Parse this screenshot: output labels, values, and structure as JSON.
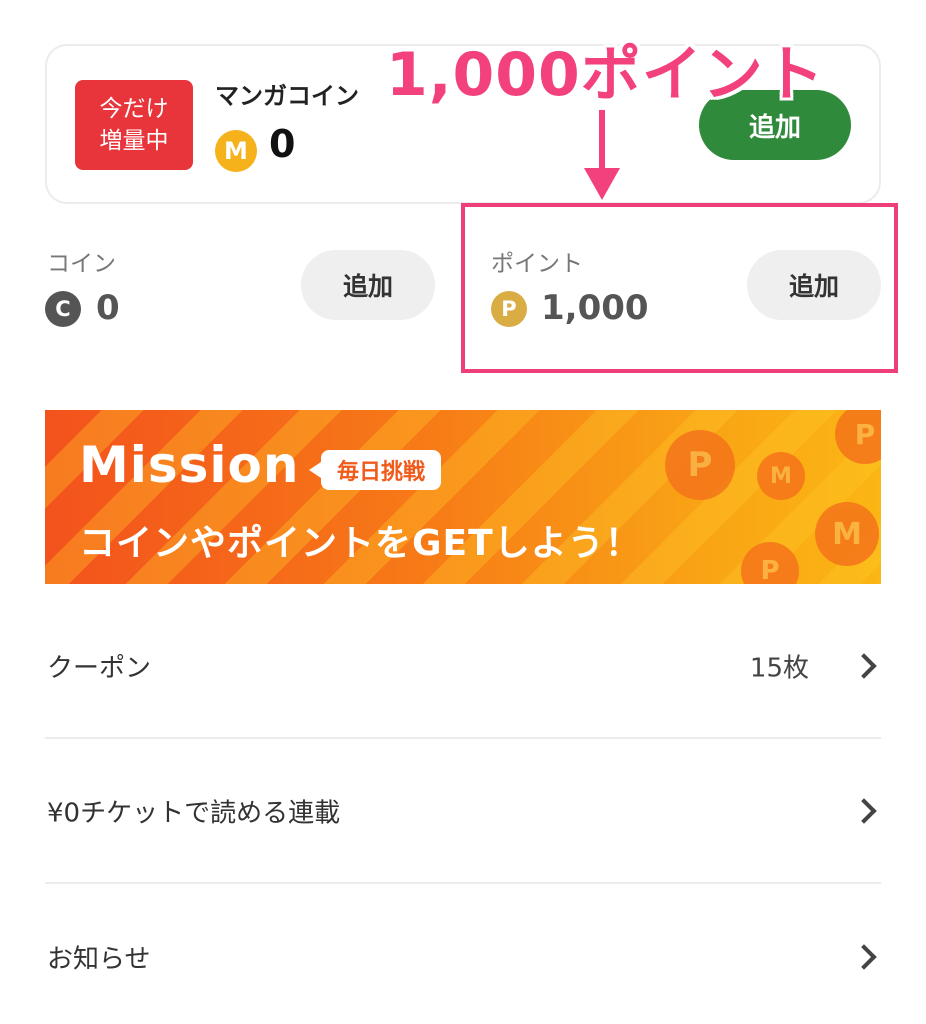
{
  "annotation": {
    "title": "1,000ポイント"
  },
  "manga_coin": {
    "badge_line1": "今だけ",
    "badge_line2": "増量中",
    "label": "マンガコイン",
    "icon": "M",
    "amount": "0",
    "add_label": "追加"
  },
  "coin": {
    "label": "コイン",
    "icon": "C",
    "amount": "0",
    "add_label": "追加"
  },
  "point": {
    "label": "ポイント",
    "icon": "P",
    "amount": "1,000",
    "add_label": "追加"
  },
  "banner": {
    "title": "Mission",
    "tag": "毎日挑戦",
    "subtitle": "コインやポイントをGETしよう！"
  },
  "menu": [
    {
      "label": "クーポン",
      "value": "15枚"
    },
    {
      "label": "¥0チケットで読める連載",
      "value": ""
    },
    {
      "label": "お知らせ",
      "value": ""
    }
  ],
  "colors": {
    "accent_pink": "#f2417c",
    "green_button": "#2f8a3c",
    "badge_red": "#e8353b",
    "manga_coin": "#f6b21b",
    "coin_gray": "#555555",
    "point_gold": "#d9ad43"
  }
}
